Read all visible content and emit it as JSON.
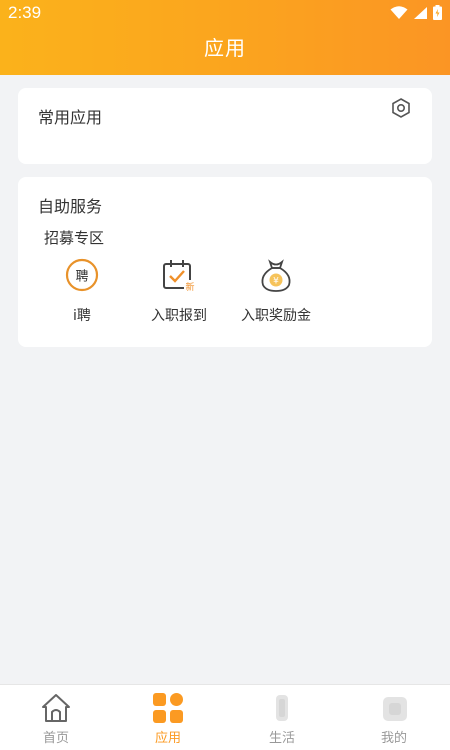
{
  "status": {
    "time": "2:39"
  },
  "header": {
    "title": "应用"
  },
  "common_apps": {
    "title": "常用应用"
  },
  "self_service": {
    "title": "自助服务",
    "section": "招募专区",
    "apps": [
      {
        "label": "i聘",
        "icon": "recruit-circle-icon"
      },
      {
        "label": "入职报到",
        "icon": "calendar-check-icon"
      },
      {
        "label": "入职奖励金",
        "icon": "money-bag-icon"
      }
    ]
  },
  "tabs": [
    {
      "label": "首页",
      "icon": "home-icon"
    },
    {
      "label": "应用",
      "icon": "apps-grid-icon"
    },
    {
      "label": "生活",
      "icon": "life-icon"
    },
    {
      "label": "我的",
      "icon": "profile-icon"
    }
  ],
  "colors": {
    "accent": "#fb9a22",
    "header_start": "#fbb21b",
    "header_end": "#fb9524"
  }
}
